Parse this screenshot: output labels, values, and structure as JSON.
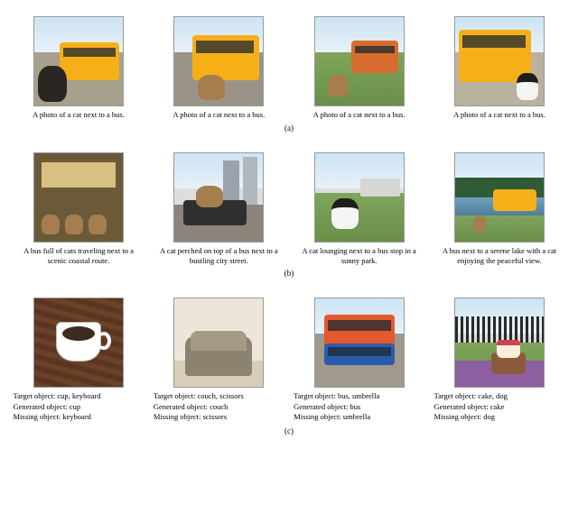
{
  "row_a": {
    "label": "(a)",
    "items": [
      {
        "caption": "A photo of a cat next to a bus."
      },
      {
        "caption": "A photo of a cat next to a bus."
      },
      {
        "caption": "A photo of a cat next to a bus."
      },
      {
        "caption": "A photo of a cat next to a bus."
      }
    ]
  },
  "row_b": {
    "label": "(b)",
    "items": [
      {
        "line1": "A bus full of cats traveling",
        "line2": "next to a scenic coastal route."
      },
      {
        "line1": "A cat perched on top of a bus",
        "line2": "next to a bustling city street."
      },
      {
        "line1": "A cat lounging next to",
        "line2": "a bus stop in a sunny park."
      },
      {
        "line1": "A bus next to a serene lake with",
        "line2": "a cat enjoying the peaceful view."
      }
    ]
  },
  "row_c": {
    "label": "(c)",
    "items": [
      {
        "target": "Target object: cup, keyboard",
        "generated": "Generated object: cup",
        "missing": "Missing object: keyboard"
      },
      {
        "target": "Target object: couch, scissors",
        "generated": "Generated object: couch",
        "missing": "Missing object: scissors"
      },
      {
        "target": "Target object: bus, umbrella",
        "generated": "Generated object: bus",
        "missing": "Missing object: umbrella"
      },
      {
        "target": "Target object: cake, dog",
        "generated": "Generated object: cake",
        "missing": "Missing object: dog"
      }
    ]
  }
}
